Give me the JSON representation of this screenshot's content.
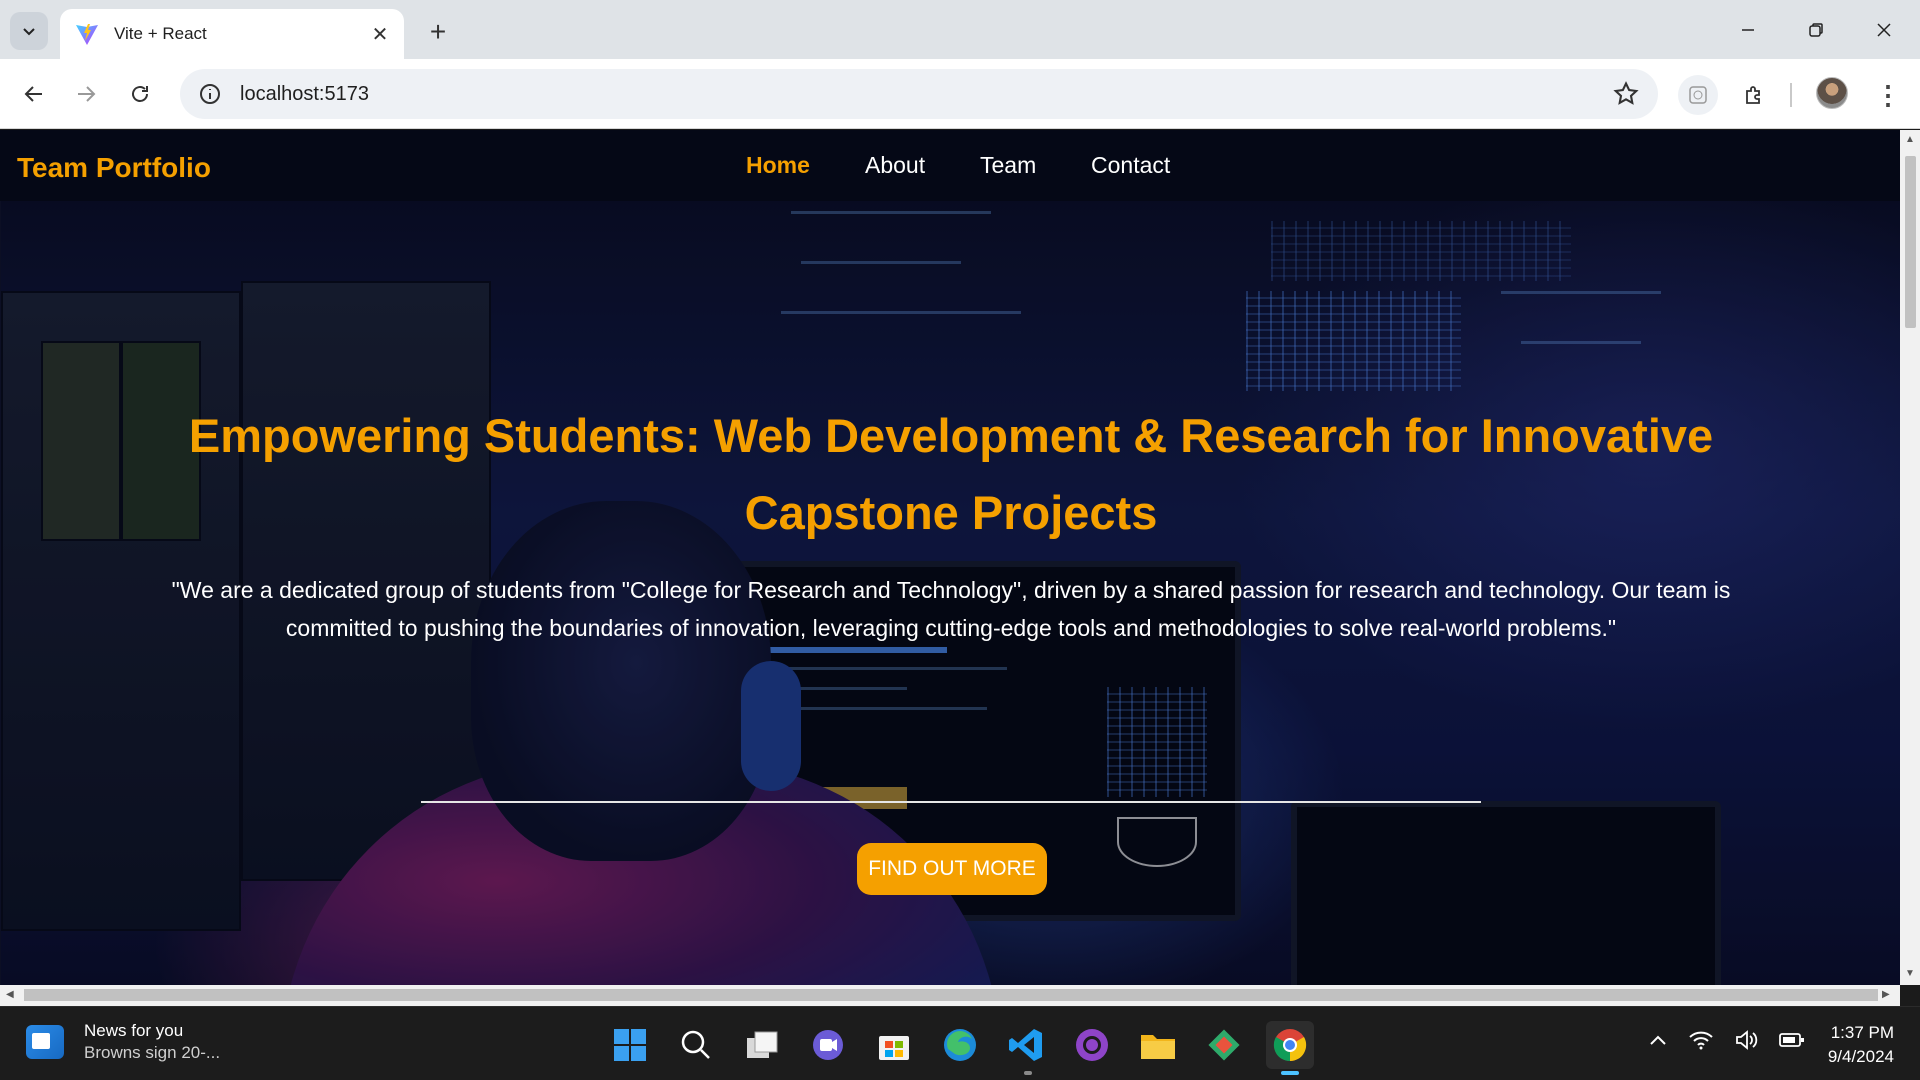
{
  "browser": {
    "tab_title": "Vite + React",
    "url": "localhost:5173"
  },
  "site": {
    "brand": "Team Portfolio",
    "nav": [
      "Home",
      "About",
      "Team",
      "Contact"
    ],
    "active_nav": "Home"
  },
  "hero": {
    "title": "Empowering Students: Web Development & Research for Innovative Capstone Projects",
    "text": "\"We are a dedicated group of students from \"College for Research and Technology\", driven by a shared passion for research and technology. Our team is committed to pushing the boundaries of innovation, leveraging cutting-edge tools and methodologies to solve real-world problems.\"",
    "cta": "FIND OUT MORE"
  },
  "taskbar": {
    "news_title": "News for you",
    "news_subtitle": "Browns sign 20-...",
    "apps": [
      "start-icon",
      "search-icon",
      "task-view-icon",
      "teams-chat-icon",
      "store-icon",
      "edge-icon",
      "vscode-icon",
      "github-desktop-icon",
      "file-explorer-icon",
      "git-icon",
      "chrome-icon"
    ],
    "time": "1:37 PM",
    "date": "9/4/2024"
  },
  "colors": {
    "accent": "#f5a000",
    "nav_bg": "#050816"
  }
}
